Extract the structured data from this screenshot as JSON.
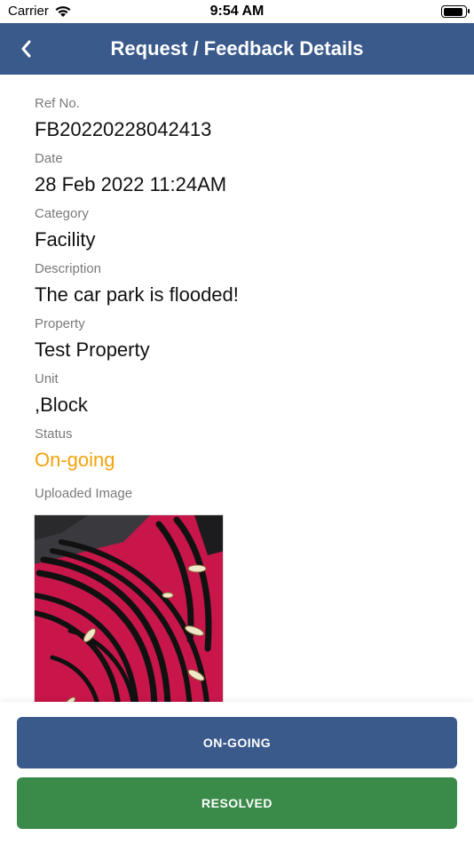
{
  "status_bar": {
    "carrier": "Carrier",
    "time": "9:54 AM",
    "battery_level": 0.95
  },
  "header": {
    "title": "Request / Feedback Details",
    "back_icon": "chevron-left-icon"
  },
  "fields": {
    "ref_no": {
      "label": "Ref No.",
      "value": "FB20220228042413"
    },
    "date": {
      "label": "Date",
      "value": "28 Feb 2022 11:24AM"
    },
    "category": {
      "label": "Category",
      "value": "Facility"
    },
    "description": {
      "label": "Description",
      "value": "The car park is flooded!"
    },
    "property": {
      "label": "Property",
      "value": "Test Property"
    },
    "unit": {
      "label": "Unit",
      "value": ",Block"
    },
    "status": {
      "label": "Status",
      "value": "On-going",
      "color": "#f5a20a"
    }
  },
  "uploaded_image": {
    "label": "Uploaded Image"
  },
  "actions": {
    "ongoing_label": "ON-GOING",
    "resolved_label": "RESOLVED"
  },
  "colors": {
    "nav": "#3a5a8c",
    "ongoing_button": "#3a5a8c",
    "resolved_button": "#3a8a4a",
    "status_text": "#f5a20a"
  }
}
